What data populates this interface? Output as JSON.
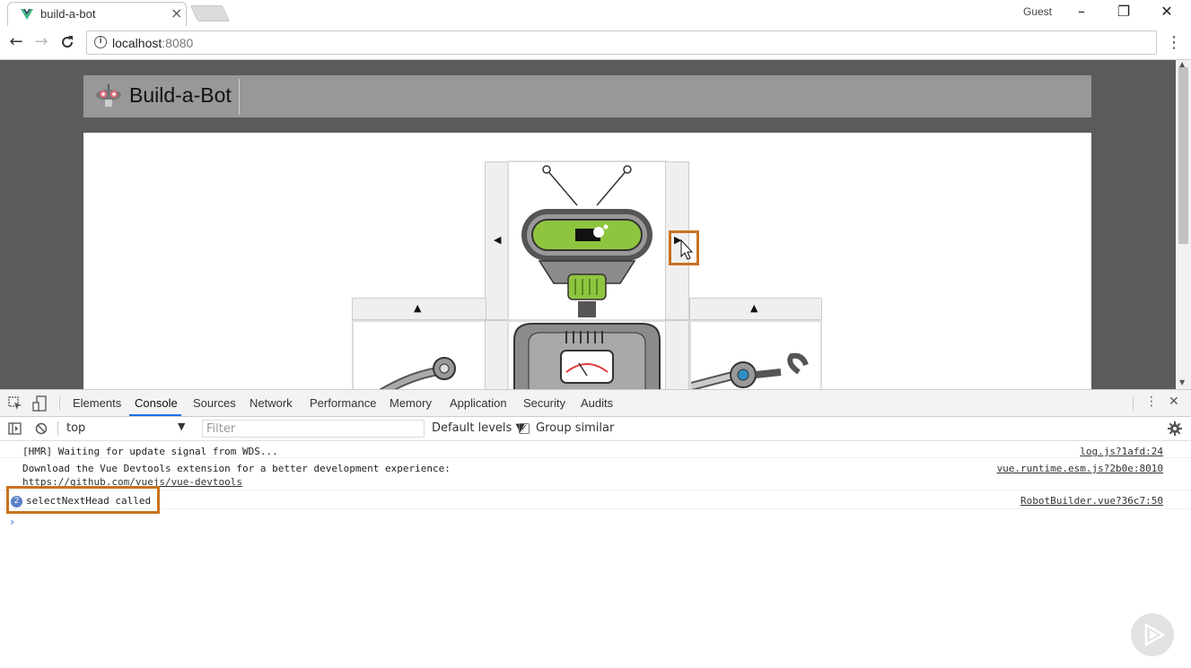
{
  "browser": {
    "tab_title": "build-a-bot",
    "tab_close": "×",
    "profile": "Guest",
    "window_controls": {
      "minimize": "–",
      "restore": "❐",
      "close": "✕"
    },
    "nav": {
      "back": "←",
      "forward": "→",
      "reload": "C"
    },
    "url_host": "localhost",
    "url_port": ":8080",
    "menu": "⋮"
  },
  "app": {
    "title": "Build-a-Bot",
    "left_arrow": "◀",
    "right_arrow": "▶",
    "up_arrow": "▲"
  },
  "devtools": {
    "tabs": [
      "Elements",
      "Console",
      "Sources",
      "Network",
      "Performance",
      "Memory",
      "Application",
      "Security",
      "Audits"
    ],
    "active_tab": "Console",
    "context": "top",
    "filter_placeholder": "Filter",
    "levels": "Default levels ▼",
    "group_similar": "Group similar",
    "group_similar_checked": true,
    "logs": [
      {
        "message": "[HMR] Waiting for update signal from WDS...",
        "source": "log.js?1afd:24"
      },
      {
        "message": "Download the Vue Devtools extension for a better development experience:",
        "link": "https://github.com/vuejs/vue-devtools",
        "source": "vue.runtime.esm.js?2b0e:8010"
      },
      {
        "message": "selectNextHead called",
        "count": "2",
        "source": "RobotBuilder.vue?36c7:50"
      }
    ],
    "prompt": "›"
  },
  "colors": {
    "highlight": "#c8721f",
    "viewport_bg": "#5b5b5b",
    "header_bg": "#989898",
    "head_green": "#8fc43f"
  }
}
